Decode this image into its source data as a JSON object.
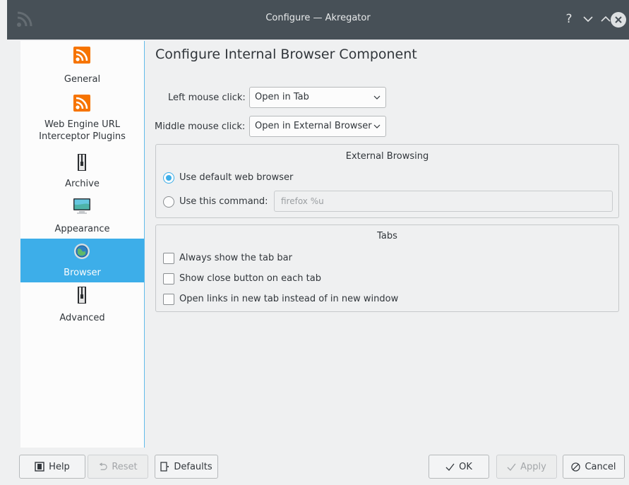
{
  "window": {
    "title": "Configure — Akregator"
  },
  "sidebar": {
    "items": [
      {
        "label": "General",
        "icon": "rss-feed-icon"
      },
      {
        "label": "Web Engine URL\nInterceptor Plugins",
        "icon": "rss-feed-icon"
      },
      {
        "label": "Archive",
        "icon": "archive-icon"
      },
      {
        "label": "Appearance",
        "icon": "monitor-icon"
      },
      {
        "label": "Browser",
        "icon": "globe-icon"
      },
      {
        "label": "Advanced",
        "icon": "archive-icon"
      }
    ],
    "active": "Browser"
  },
  "page": {
    "title": "Configure Internal Browser Component"
  },
  "form": {
    "left_click_label": "Left mouse click:",
    "left_click_value": "Open in Tab",
    "middle_click_label": "Middle mouse click:",
    "middle_click_value": "Open in External Browser"
  },
  "external_browsing": {
    "title": "External Browsing",
    "default_label": "Use default web browser",
    "default_selected": true,
    "command_label": "Use this command:",
    "command_value": "firefox %u"
  },
  "tabs": {
    "title": "Tabs",
    "options": [
      {
        "label": "Always show the tab bar",
        "checked": false
      },
      {
        "label": "Show close button on each tab",
        "checked": false
      },
      {
        "label": "Open links in new tab instead of in new window",
        "checked": false
      }
    ]
  },
  "buttons": {
    "help": "Help",
    "reset": "Reset",
    "defaults": "Defaults",
    "ok": "OK",
    "apply": "Apply",
    "cancel": "Cancel"
  },
  "colors": {
    "accent": "#3daee9",
    "titlebar": "#475057",
    "rss": "#f67400"
  }
}
